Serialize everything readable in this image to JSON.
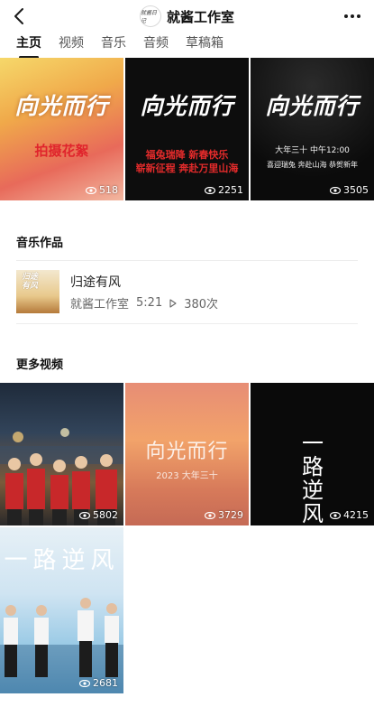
{
  "header": {
    "title": "就酱工作室",
    "avatar_text": "就酱日记"
  },
  "tabs": [
    {
      "label": "主页",
      "active": true
    },
    {
      "label": "视频",
      "active": false
    },
    {
      "label": "音乐",
      "active": false
    },
    {
      "label": "音频",
      "active": false
    },
    {
      "label": "草稿箱",
      "active": false
    }
  ],
  "top_videos": [
    {
      "title_art": "向光而行",
      "caption": "拍摄花絮",
      "views": "518"
    },
    {
      "title_art": "向光而行",
      "caption_lines": [
        "福兔瑞降 新春快乐",
        "崭新征程 奔赴万里山海"
      ],
      "views": "2251"
    },
    {
      "title_art": "向光而行",
      "caption_lines": [
        "大年三十 中午12:00",
        "喜迎瑞兔 奔赴山海 恭贺新年"
      ],
      "views": "3505"
    }
  ],
  "music_section": {
    "title": "音乐作品",
    "items": [
      {
        "cover_text": "归途有风",
        "name": "归途有风",
        "artist": "就酱工作室",
        "duration": "5:21",
        "plays": "380次"
      }
    ]
  },
  "more_videos": {
    "title": "更多视频",
    "items": [
      {
        "views": "5802"
      },
      {
        "title_art": "向光而行",
        "caption": "2023 大年三十",
        "views": "3729"
      },
      {
        "title_art": "一路逆风",
        "views": "4215"
      },
      {
        "title_art": "一路逆风",
        "views": "2681"
      }
    ]
  },
  "colors": {
    "accent": "#1a1a1a",
    "red_text": "#e52b2b",
    "muted": "#666666"
  },
  "icons": [
    "back-arrow-icon",
    "more-dots-icon",
    "eye-icon",
    "play-icon"
  ]
}
